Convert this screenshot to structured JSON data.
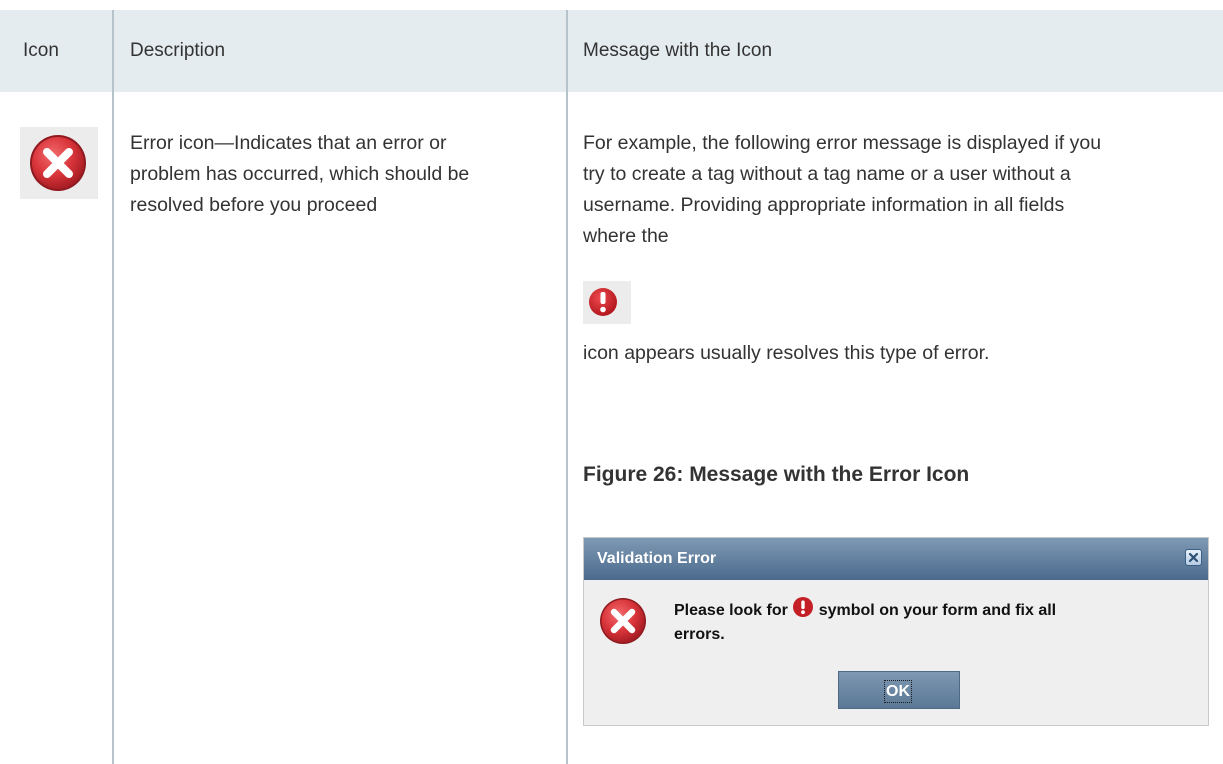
{
  "table": {
    "headers": {
      "icon": "Icon",
      "description": "Description",
      "message": "Message with the Icon"
    },
    "row": {
      "icon_name": "error-icon",
      "description_lines": [
        "Error icon—Indicates that an error or",
        "problem has occurred, which should be",
        "resolved before you proceed"
      ],
      "message_lines_before_icon": [
        "For example, the following error message is displayed if you",
        "try to create a tag without a tag name or a user without a",
        "username. Providing appropriate information in all fields",
        "where the"
      ],
      "inline_icon_name": "exclamation-icon",
      "message_after_icon": "icon appears usually resolves this type of error.",
      "figure_caption": "Figure 26: Message with the Error Icon"
    }
  },
  "dialog": {
    "title": "Validation Error",
    "close_icon": "close-icon",
    "error_icon": "error-icon",
    "message_before_icon": "Please look for",
    "message_after_icon": "symbol on your form and fix all",
    "message_line2": "errors.",
    "ok_label": "OK"
  },
  "colors": {
    "header_bg": "#e4ecef",
    "divider": "#b6c3ca",
    "error_red": "#d8343a",
    "dialog_title_top": "#7e99b4",
    "dialog_title_bottom": "#4b6a8c"
  }
}
